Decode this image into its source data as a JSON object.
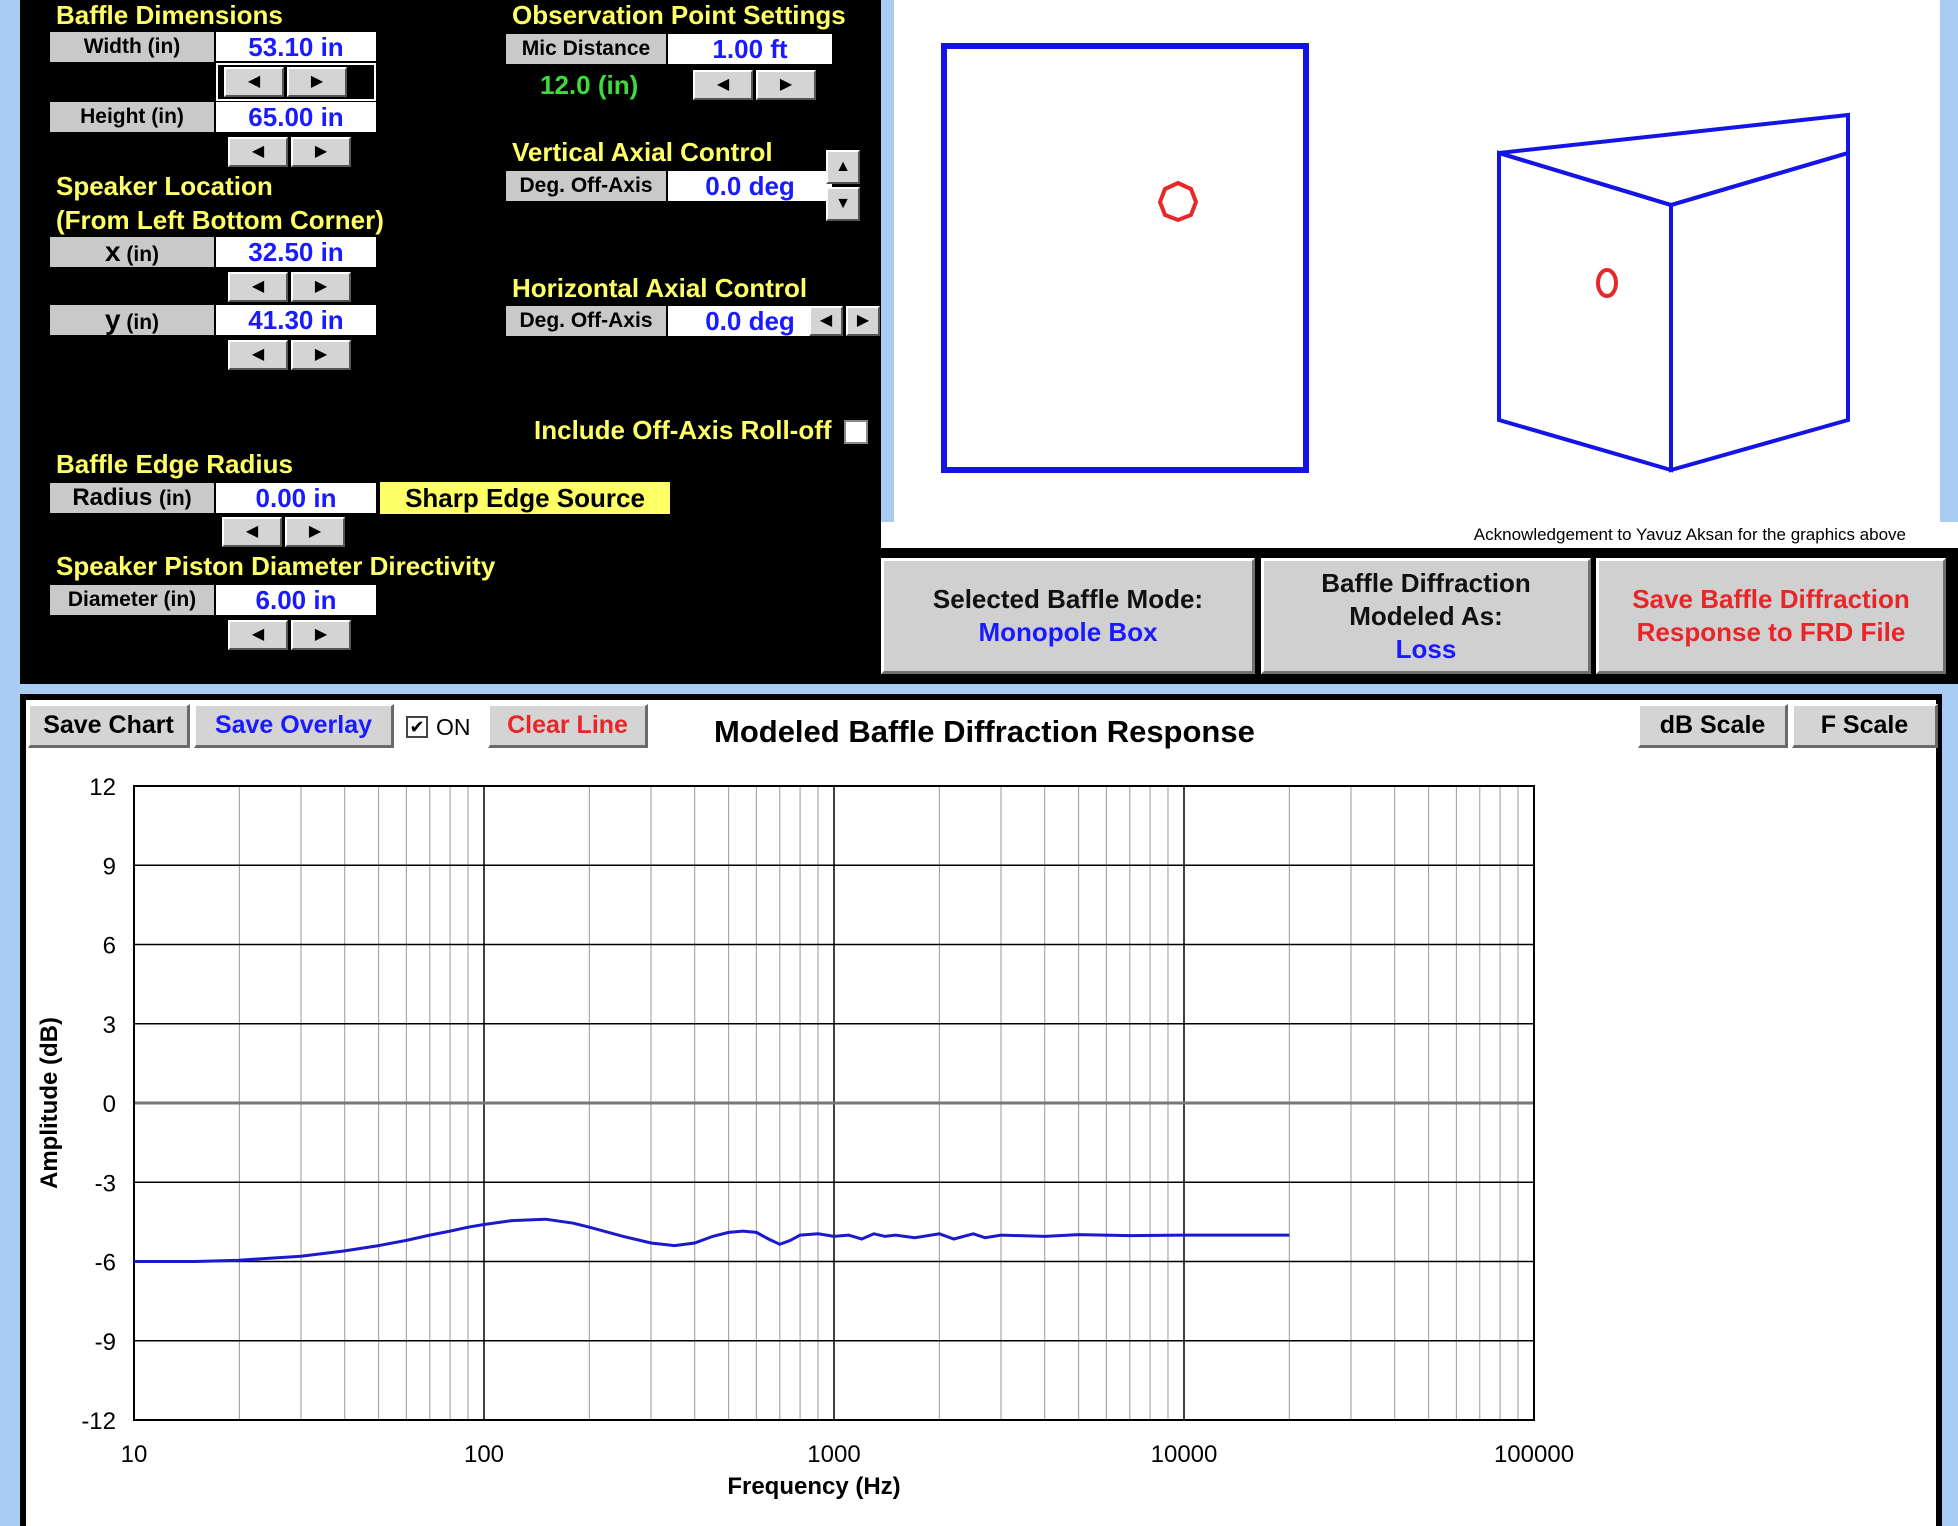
{
  "baffle_dimensions": {
    "title": "Baffle Dimensions",
    "width_label": "Width (in)",
    "width_value": "53.10 in",
    "height_label": "Height (in)",
    "height_value": "65.00 in"
  },
  "speaker_location": {
    "title": "Speaker Location",
    "subtitle": "(From Left Bottom Corner)",
    "x_label_big": "x",
    "x_label_small": "(in)",
    "x_value": "32.50 in",
    "y_label_big": "y",
    "y_label_small": "(in)",
    "y_value": "41.30 in"
  },
  "observation": {
    "title": "Observation Point Settings",
    "mic_label": "Mic Distance",
    "mic_value": "1.00 ft",
    "mic_inches": "12.0 (in)"
  },
  "vertical_axial": {
    "title": "Vertical Axial Control",
    "label": "Deg. Off-Axis",
    "value": "0.0 deg"
  },
  "horizontal_axial": {
    "title": "Horizontal Axial Control",
    "label": "Deg. Off-Axis",
    "value": "0.0 deg"
  },
  "rolloff": {
    "label": "Include Off-Axis Roll-off",
    "checked": false
  },
  "edge_radius": {
    "title": "Baffle Edge Radius",
    "label_big": "Radius",
    "label_small": "(in)",
    "value": "0.00 in",
    "source_label": "Sharp Edge Source"
  },
  "piston": {
    "title": "Speaker Piston Diameter Directivity",
    "label": "Diameter (in)",
    "value": "6.00 in"
  },
  "graphics": {
    "acknowledgement": "Acknowledgement to Yavuz Aksan for the graphics above"
  },
  "mode": {
    "selected_key": "Selected Baffle Mode:",
    "selected_value": "Monopole Box",
    "modeled_key_1": "Baffle Diffraction",
    "modeled_key_2": "Modeled As:",
    "modeled_value": "Loss",
    "save_frd_1": "Save Baffle Diffraction",
    "save_frd_2": "Response to FRD File"
  },
  "toolbar": {
    "save_chart": "Save Chart",
    "save_overlay": "Save Overlay",
    "overlay_on": "ON",
    "overlay_checked": true,
    "clear_line": "Clear Line",
    "db_scale": "dB Scale",
    "f_scale": "F Scale"
  },
  "colors": {
    "panel_bg": "#000000",
    "title_yellow": "#ffff66",
    "value_blue": "#1a1aff",
    "accent_green": "#3ddc3d",
    "alert_red": "#e8262a",
    "page_bg": "#a8ccf4",
    "curve_blue": "#1a1acc",
    "shape_blue": "#1414e6",
    "speaker_red": "#e82828"
  },
  "chart_data": {
    "type": "line",
    "title": "Modeled Baffle Diffraction Response",
    "xlabel": "Frequency (Hz)",
    "ylabel": "Amplitude (dB)",
    "x_scale": "log",
    "xlim": [
      10,
      100000
    ],
    "ylim": [
      -12,
      12
    ],
    "x_ticks": [
      10,
      100,
      1000,
      10000,
      100000
    ],
    "y_ticks": [
      12,
      9,
      6,
      3,
      0,
      -3,
      -6,
      -9,
      -12
    ],
    "grid": true,
    "legend": "none",
    "series": [
      {
        "x": [
          10,
          15,
          20,
          30,
          40,
          50,
          60,
          70,
          80,
          90,
          100,
          120,
          150,
          180,
          200,
          250,
          300,
          350,
          400,
          450,
          500,
          550,
          600,
          650,
          700,
          750,
          800,
          900,
          1000,
          1100,
          1200,
          1300,
          1400,
          1500,
          1700,
          2000,
          2200,
          2500,
          2700,
          3000,
          4000,
          5000,
          7000,
          10000,
          15000,
          20000
        ],
        "y": [
          -6.0,
          -6.0,
          -5.95,
          -5.8,
          -5.6,
          -5.4,
          -5.2,
          -5.0,
          -4.85,
          -4.7,
          -4.6,
          -4.45,
          -4.4,
          -4.55,
          -4.7,
          -5.05,
          -5.3,
          -5.4,
          -5.3,
          -5.05,
          -4.9,
          -4.85,
          -4.9,
          -5.15,
          -5.35,
          -5.2,
          -5.0,
          -4.95,
          -5.05,
          -5.0,
          -5.15,
          -4.95,
          -5.05,
          -5.0,
          -5.1,
          -4.95,
          -5.15,
          -4.95,
          -5.1,
          -5.0,
          -5.05,
          -4.98,
          -5.02,
          -5.0,
          -5.0,
          -5.0
        ]
      }
    ]
  }
}
